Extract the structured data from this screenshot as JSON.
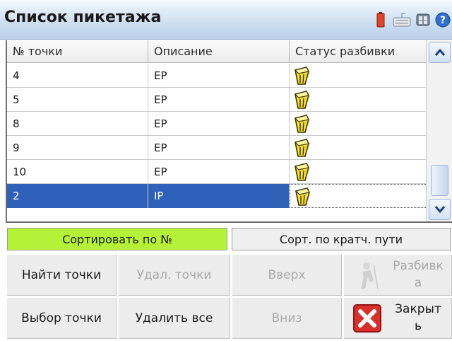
{
  "window": {
    "title": "Список пикетажа",
    "status_icons": [
      "battery-icon",
      "keyboard-icon",
      "settings-icon",
      "help-icon"
    ]
  },
  "table": {
    "headers": [
      "№ точки",
      "Описание",
      "Статус разбивки"
    ],
    "rows": [
      {
        "point": "4",
        "description": "EP",
        "status_icon": "stakeout-status-icon"
      },
      {
        "point": "5",
        "description": "EP",
        "status_icon": "stakeout-status-icon"
      },
      {
        "point": "8",
        "description": "EP",
        "status_icon": "stakeout-status-icon"
      },
      {
        "point": "9",
        "description": "EP",
        "status_icon": "stakeout-status-icon"
      },
      {
        "point": "10",
        "description": "EP",
        "status_icon": "stakeout-status-icon"
      },
      {
        "point": "2",
        "description": "IP",
        "status_icon": "stakeout-status-icon",
        "selected": true
      }
    ]
  },
  "sort": {
    "by_number": "Сортировать по №",
    "by_path": "Сорт. по кратч. пути",
    "active": "by_number"
  },
  "buttons": {
    "find_points": "Найти точки",
    "delete_points": "Удал. точки",
    "up": "Вверх",
    "stakeout_part1": "Разбивк",
    "stakeout_part2": "а",
    "select_point": "Выбор точки",
    "delete_all": "Удалить все",
    "down": "Вниз",
    "close_part1": "Закрыт",
    "close_part2": "ь"
  },
  "colors": {
    "selection": "#2e62b8",
    "sort_active": "#b4f237",
    "status_icon": "#f5e02c"
  }
}
